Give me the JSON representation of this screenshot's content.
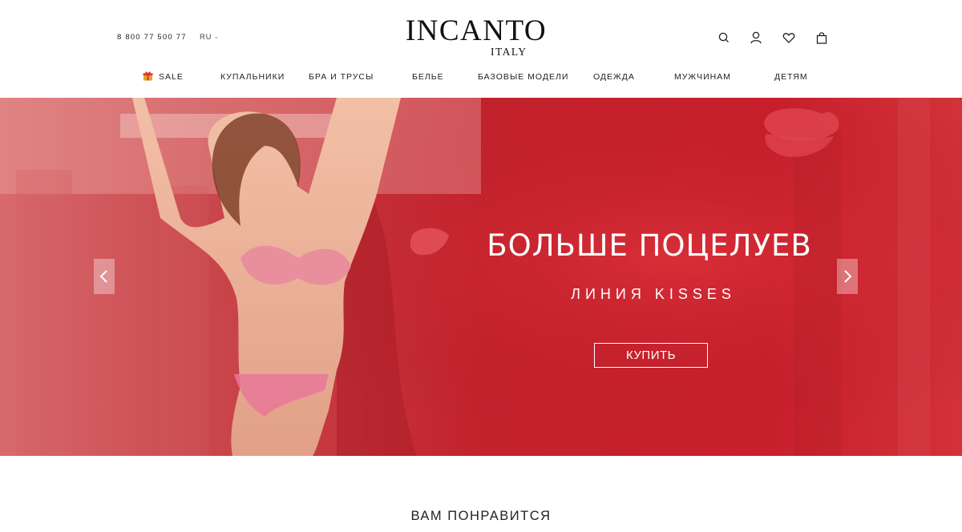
{
  "header": {
    "phone": "8 800 77 500 77",
    "language": "RU",
    "logo_main": "INCANTO",
    "logo_sub": "ITALY",
    "icons": [
      "search-icon",
      "user-icon",
      "heart-icon",
      "bag-icon"
    ]
  },
  "nav": {
    "items": [
      {
        "label": "SALE",
        "icon": "gift-icon"
      },
      {
        "label": "КУПАЛЬНИКИ"
      },
      {
        "label": "БРА И ТРУСЫ"
      },
      {
        "label": "БЕЛЬЕ"
      },
      {
        "label": "БАЗОВЫЕ МОДЕЛИ"
      },
      {
        "label": "ОДЕЖДА"
      },
      {
        "label": "МУЖЧИНАМ"
      },
      {
        "label": "ДЕТЯМ"
      }
    ]
  },
  "hero": {
    "title": "БОЛЬШЕ ПОЦЕЛУЕВ",
    "subtitle": "ЛИНИЯ KISSES",
    "button": "КУПИТЬ",
    "accent_color": "#c8202a"
  },
  "section": {
    "title": "ВАМ ПОНРАВИТСЯ"
  }
}
